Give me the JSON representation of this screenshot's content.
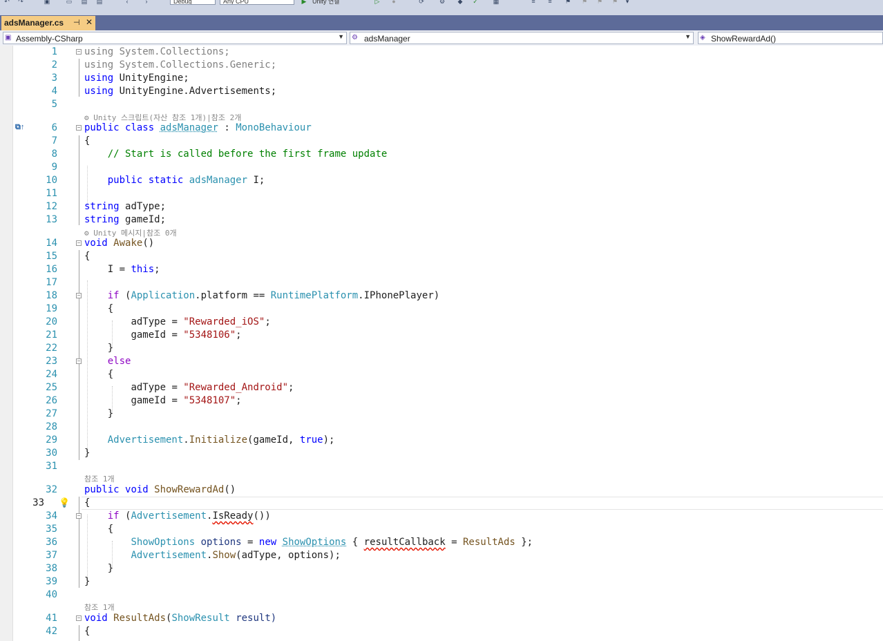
{
  "toolbar": {
    "config_value": "Debug",
    "platform_value": "Any CPU",
    "run_label": "Unity 연결"
  },
  "tab": {
    "title": "adsManager.cs",
    "pin_glyph": "⊣",
    "close_glyph": "✕"
  },
  "navbar": {
    "project": "Assembly-CSharp",
    "type": "adsManager",
    "member": "ShowRewardAd()"
  },
  "codelens": {
    "class_refs": "Unity 스크립트(자산 참조 1개)|참조 2개",
    "awake_refs": "Unity 메시지|참조 0개",
    "showreward_refs": "참조 1개",
    "resultads_refs": "참조 1개"
  },
  "line_numbers": [
    "1",
    "2",
    "3",
    "4",
    "5",
    "6",
    "7",
    "8",
    "9",
    "10",
    "11",
    "12",
    "13",
    "14",
    "15",
    "16",
    "17",
    "18",
    "19",
    "20",
    "21",
    "22",
    "23",
    "24",
    "25",
    "26",
    "27",
    "28",
    "29",
    "30",
    "31",
    "32",
    "33",
    "34",
    "35",
    "36",
    "37",
    "38",
    "39",
    "40",
    "41",
    "42"
  ],
  "code": {
    "using": "using",
    "ns1": "System.Collections;",
    "ns2": "System.Collections.Generic;",
    "ns3": "UnityEngine;",
    "ns4": "UnityEngine.Advertisements;",
    "public": "public",
    "class": "class",
    "static": "static",
    "void": "void",
    "string": "string",
    "if": "if",
    "else": "else",
    "this": "this",
    "new": "new",
    "true": "true",
    "className": "adsManager",
    "baseClass": "MonoBehaviour",
    "comment": "// Start is called before the first frame update",
    "field_adType": "adType;",
    "field_gameId": "gameId;",
    "awake": "Awake",
    "application": "Application",
    "platform": ".platform == ",
    "runtimePlatform": "RuntimePlatform",
    "iphone": ".IPhonePlayer)",
    "adTypeAssign": "adType = ",
    "gameIdAssign": "gameId = ",
    "ios_type": "\"Rewarded_iOS\"",
    "ios_id": "\"5348106\"",
    "android_type": "\"Rewarded_Android\"",
    "android_id": "\"5348107\"",
    "advertisement": "Advertisement",
    "initialize": "Initialize",
    "init_args1": "(gameId, ",
    "init_args2": ");",
    "showRewardAd": "ShowRewardAd",
    "isReady": "IsReady",
    "showOptions": "ShowOptions",
    "options_var": "options",
    "resultCallback": "resultCallback",
    "resultAds": "ResultAds",
    "show": "Show",
    "show_args": "(adType, options);",
    "showResult": "ShowResult",
    "result_param": "result)"
  }
}
